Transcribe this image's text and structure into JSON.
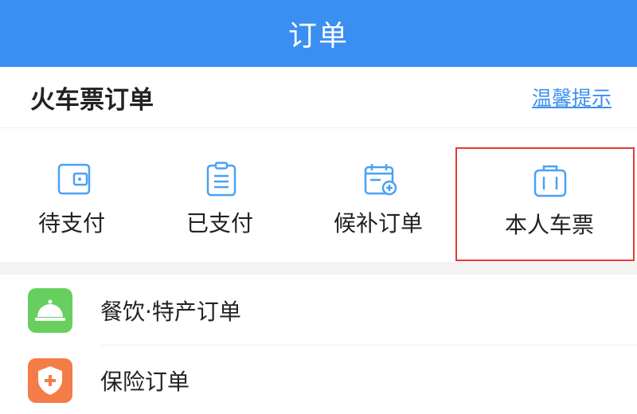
{
  "header": {
    "title": "订单"
  },
  "section": {
    "title": "火车票订单",
    "tips_link": "温馨提示"
  },
  "order_grid": [
    {
      "label": "待支付",
      "icon": "wallet-icon"
    },
    {
      "label": "已支付",
      "icon": "clipboard-icon"
    },
    {
      "label": "候补订单",
      "icon": "calendar-plus-icon"
    },
    {
      "label": "本人车票",
      "icon": "suitcase-icon"
    }
  ],
  "list": [
    {
      "label": "餐饮·特产订单",
      "icon": "service-bell-icon",
      "color": "#67cf5e"
    },
    {
      "label": "保险订单",
      "icon": "shield-plus-icon",
      "color": "#f47c47"
    }
  ],
  "colors": {
    "primary": "#3a8ff0",
    "icon_blue": "#4aa0f5",
    "highlight": "#e53935"
  }
}
